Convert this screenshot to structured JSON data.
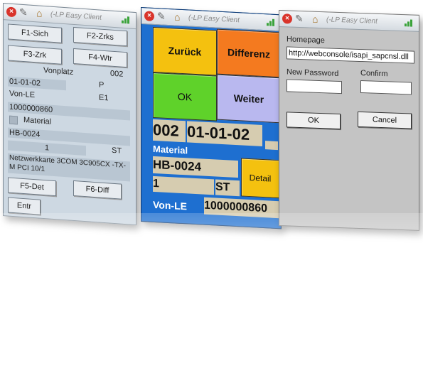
{
  "app": {
    "title": "(-LP Easy Client",
    "close_glyph": "×",
    "tools_icon": "tools-icon",
    "home_icon": "home-icon",
    "signal_icon": "signal-icon"
  },
  "panel1": {
    "buttons": {
      "f1": "F1-Sich",
      "f2": "F2-Zrks",
      "f3": "F3-Zrk",
      "f4": "F4-Wtr",
      "f5": "F5-Det",
      "f6": "F6-Diff",
      "entr": "Entr"
    },
    "vonplatz_label": "Vonplatz",
    "vonplatz_value": "002",
    "location": "01-01-02",
    "p_flag": "P",
    "vonle_label": "Von-LE",
    "e_flag": "E1",
    "le_number": "1000000860",
    "material_label": "Material",
    "material_value": "HB-0024",
    "qty": "1",
    "unit": "ST",
    "description": "Netzwerkkarte 3COM 3C905CX -TX-M PCI 10/1"
  },
  "panel2": {
    "zuruck": "Zurück",
    "differenz": "Differenz",
    "ok": "OK",
    "weiter": "Weiter",
    "bin": "002",
    "location": "01-01-02",
    "material_label": "Material",
    "material_value": "HB-0024",
    "detail": "Detail",
    "qty": "1",
    "unit": "ST",
    "vonle_label": "Von-LE",
    "le_number": "1000000860",
    "colors": {
      "yellow": "#f4c10f",
      "orange": "#f47a1f",
      "green": "#5fd22a",
      "lavender": "#b9b8ef",
      "blue": "#1e6fd0"
    }
  },
  "panel3": {
    "homepage_label": "Homepage",
    "homepage_value": "http://webconsole/isapi_sapcnsl.dll",
    "new_password_label": "New Password",
    "confirm_label": "Confirm",
    "new_password_value": "",
    "confirm_value": "",
    "ok": "OK",
    "cancel": "Cancel"
  }
}
